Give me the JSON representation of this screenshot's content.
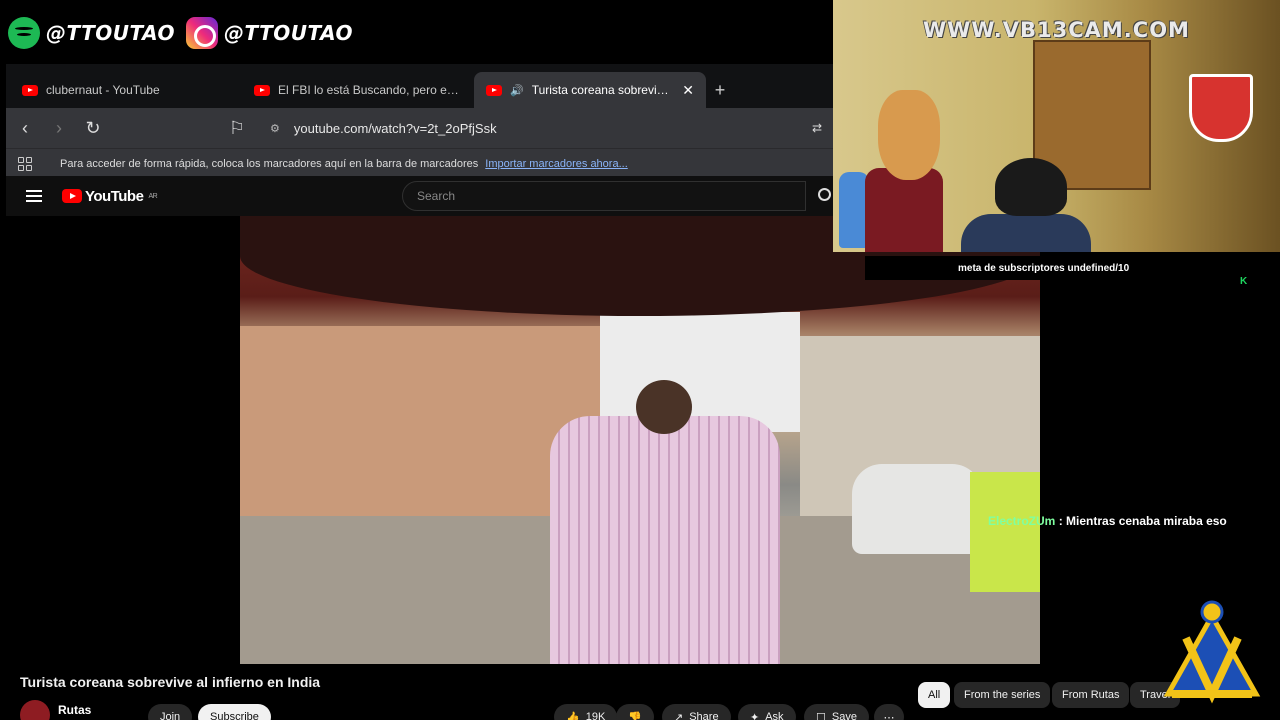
{
  "overlay": {
    "spotify_handle": "@TTOUTAO",
    "instagram_handle": "@TTOUTAO",
    "watermark": "WWW.VB13CAM.COM",
    "subs_goal": "meta de subscriptores undefined/10",
    "status_marker": "K",
    "chat": {
      "user": "ElectroZUm",
      "message": " : Mientras cenaba miraba eso"
    }
  },
  "browser": {
    "tabs": [
      {
        "title": "clubernaut - YouTube",
        "active": false
      },
      {
        "title": "El FBI lo está Buscando, pero es Impo",
        "active": false
      },
      {
        "title": "Turista coreana sobrevive al i",
        "active": true
      }
    ],
    "url": "youtube.com/watch?v=2t_2oPfjSsk",
    "bookmarks_text": "Para acceder de forma rápida, coloca los marcadores aquí en la barra de marcadores",
    "bookmarks_link": "Importar marcadores ahora..."
  },
  "youtube": {
    "logo": "YouTube",
    "region": "AR",
    "search_placeholder": "Search",
    "title": "Turista coreana sobrevive al infierno en India",
    "channel": "Rutas",
    "join": "Join",
    "subscribe": "Subscribe",
    "likes": "19K",
    "share": "Share",
    "ask": "Ask",
    "save": "Save",
    "chips": [
      "All",
      "From the series",
      "From Rutas",
      "Travel"
    ]
  },
  "colors": {
    "yt_red": "#ff0000",
    "spotify_green": "#1DB954",
    "bg": "#000000"
  }
}
